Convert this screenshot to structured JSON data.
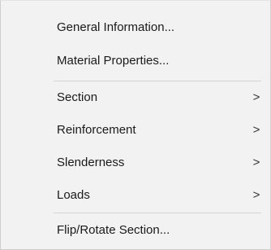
{
  "menu": {
    "items": [
      {
        "label": "General Information..."
      },
      {
        "label": "Material Properties..."
      },
      {
        "label": "Section",
        "arrow": ">"
      },
      {
        "label": "Reinforcement",
        "arrow": ">"
      },
      {
        "label": "Slenderness",
        "arrow": ">"
      },
      {
        "label": "Loads",
        "arrow": ">"
      },
      {
        "label": "Flip/Rotate Section..."
      }
    ]
  }
}
